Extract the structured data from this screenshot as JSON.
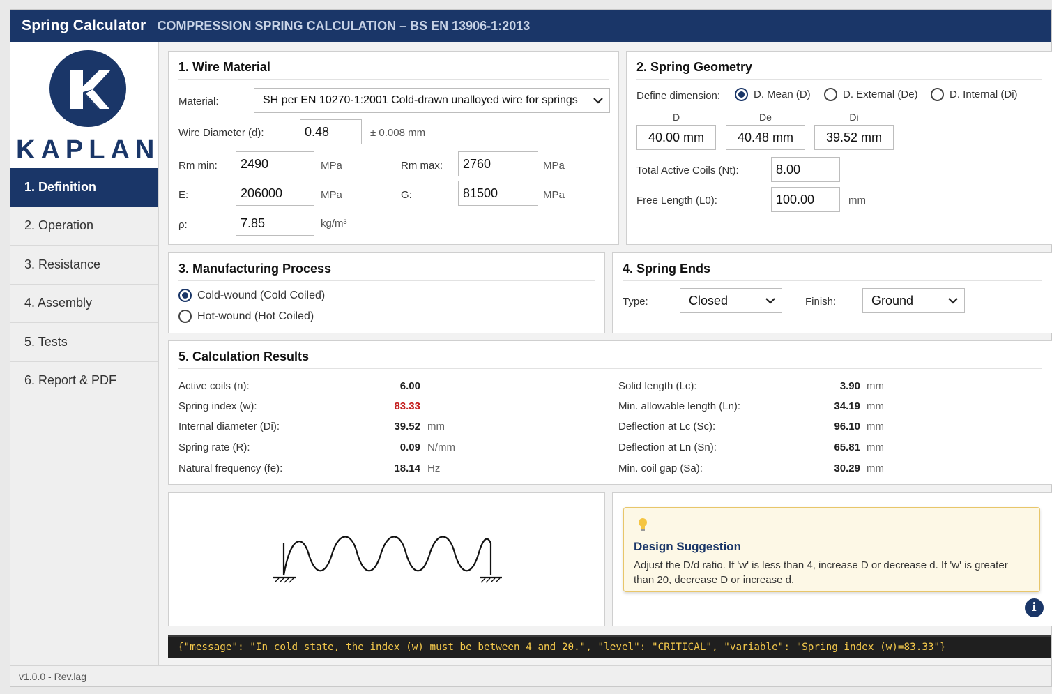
{
  "header": {
    "app_title": "Spring Calculator",
    "subtitle": "COMPRESSION SPRING CALCULATION – BS EN 13906-1:2013"
  },
  "sidebar": {
    "logo_text": "KAPLAN",
    "items": [
      {
        "label": "1. Definition",
        "active": true
      },
      {
        "label": "2. Operation"
      },
      {
        "label": "3. Resistance"
      },
      {
        "label": "4. Assembly"
      },
      {
        "label": "5. Tests"
      },
      {
        "label": "6. Report & PDF"
      }
    ],
    "version": "v1.0.0 - Rev.lag"
  },
  "wire": {
    "title": "1. Wire Material",
    "material_label": "Material:",
    "material_value": "SH per EN 10270-1:2001 Cold-drawn unalloyed wire for springs",
    "diameter_label": "Wire Diameter (d):",
    "diameter_value": "0.48",
    "tolerance": "± 0.008 mm",
    "rm_min_label": "Rm min:",
    "rm_min_value": "2490",
    "rm_max_label": "Rm max:",
    "rm_max_value": "2760",
    "e_label": "E:",
    "e_value": "206000",
    "g_label": "G:",
    "g_value": "81500",
    "rho_label": "ρ:",
    "rho_value": "7.85",
    "unit_mpa": "MPa",
    "unit_density": "kg/m³"
  },
  "geometry": {
    "title": "2. Spring Geometry",
    "define_label": "Define dimension:",
    "options": [
      "D. Mean (D)",
      "D. External (De)",
      "D. Internal (Di)"
    ],
    "selected": "D. Mean (D)",
    "head_d": "D",
    "head_de": "De",
    "head_di": "Di",
    "d_value": "40.00 mm",
    "de_value": "40.48 mm",
    "di_value": "39.52 mm",
    "coils_label": "Total Active Coils (Nt):",
    "coils_value": "8.00",
    "free_length_label": "Free Length (L0):",
    "free_length_value": "100.00",
    "free_length_unit": "mm"
  },
  "manufacturing": {
    "title": "3. Manufacturing Process",
    "options": [
      "Cold-wound (Cold Coiled)",
      "Hot-wound (Hot Coiled)"
    ],
    "selected": "Cold-wound (Cold Coiled)"
  },
  "ends": {
    "title": "4. Spring Ends",
    "type_label": "Type:",
    "type_value": "Closed",
    "finish_label": "Finish:",
    "finish_value": "Ground"
  },
  "results": {
    "title": "5. Calculation Results",
    "left": [
      {
        "label": "Active coils (n):",
        "value": "6.00",
        "unit": ""
      },
      {
        "label": "Spring index (w):",
        "value": "83.33",
        "unit": "",
        "critical": true
      },
      {
        "label": "Internal diameter (Di):",
        "value": "39.52",
        "unit": "mm"
      },
      {
        "label": "Spring rate (R):",
        "value": "0.09",
        "unit": "N/mm"
      },
      {
        "label": "Natural frequency (fe):",
        "value": "18.14",
        "unit": "Hz"
      }
    ],
    "right": [
      {
        "label": "Solid length (Lc):",
        "value": "3.90",
        "unit": "mm"
      },
      {
        "label": "Min. allowable length (Ln):",
        "value": "34.19",
        "unit": "mm"
      },
      {
        "label": "Deflection at Lc (Sc):",
        "value": "96.10",
        "unit": "mm"
      },
      {
        "label": "Deflection at Ln (Sn):",
        "value": "65.81",
        "unit": "mm"
      },
      {
        "label": "Min. coil gap (Sa):",
        "value": "30.29",
        "unit": "mm"
      }
    ]
  },
  "suggestion": {
    "icon": "lightbulb-icon",
    "title": "Design Suggestion",
    "text": "Adjust the D/d ratio. If 'w' is less than 4, increase D or decrease d. If 'w' is greater than 20, decrease D or increase d.",
    "info_glyph": "i"
  },
  "console": {
    "text": "{\"message\": \"In cold state, the index (w) must be between 4 and 20.\", \"level\": \"CRITICAL\", \"variable\": \"Spring index (w)=83.33\"}"
  },
  "colors": {
    "brand": "#1a3668",
    "critical": "#c41e1e",
    "console_text": "#f3c84b"
  }
}
